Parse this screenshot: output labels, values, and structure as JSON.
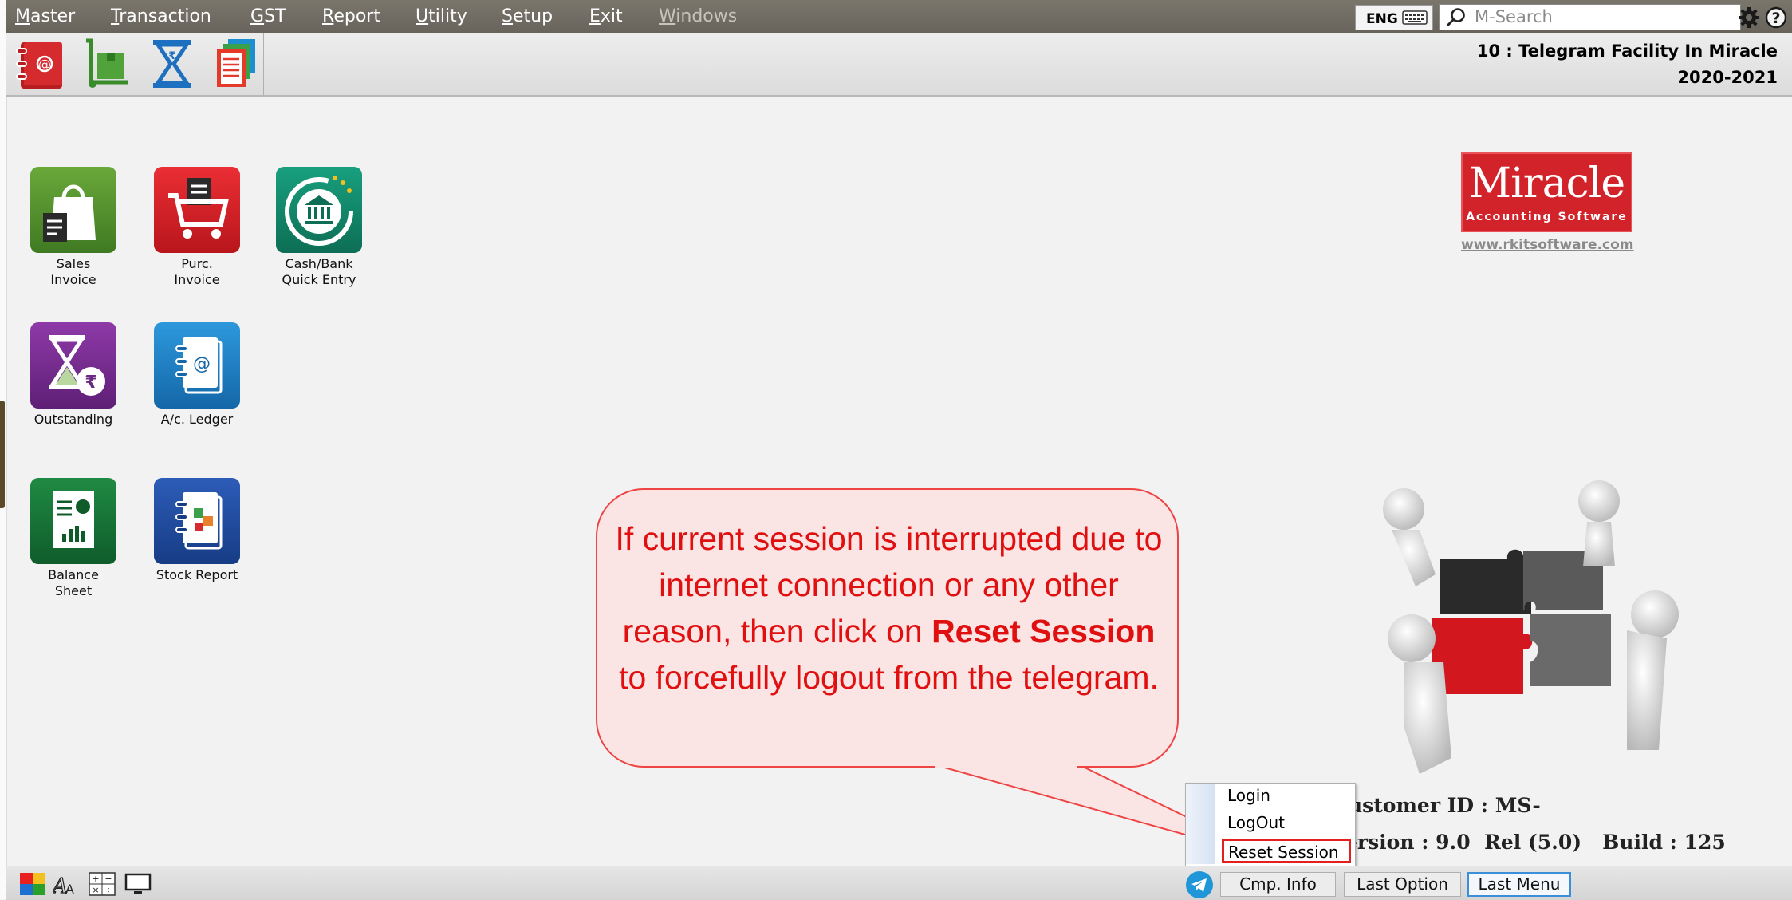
{
  "menubar": {
    "items": [
      {
        "key": "M",
        "rest": "aster"
      },
      {
        "key": "T",
        "rest": "ransaction"
      },
      {
        "key": "G",
        "rest": "ST"
      },
      {
        "key": "R",
        "rest": "eport"
      },
      {
        "key": "U",
        "rest": "tility"
      },
      {
        "key": "S",
        "rest": "etup"
      },
      {
        "key": "E",
        "rest": "xit"
      },
      {
        "key": "W",
        "rest": "indows"
      }
    ],
    "language": "ENG",
    "search_placeholder": "M-Search"
  },
  "toolbar": {
    "icons": [
      "ledger-book-icon",
      "trolley-box-icon",
      "rupee-hourglass-icon",
      "report-stack-icon"
    ],
    "company_line1": "10 : Telegram Facility In Miracle",
    "company_line2": "2020-2021"
  },
  "desktop": {
    "icons": [
      {
        "name": "sales-invoice",
        "label1": "Sales",
        "label2": "Invoice",
        "color": "#4f8a2a"
      },
      {
        "name": "purc-invoice",
        "label1": "Purc.",
        "label2": "Invoice",
        "color": "#d91f26"
      },
      {
        "name": "cash-bank-quick-entry",
        "label1": "Cash/Bank",
        "label2": "Quick Entry",
        "color": "#12876b"
      },
      {
        "name": "outstanding",
        "label1": "Outstanding",
        "label2": "",
        "color": "#7a2a8c"
      },
      {
        "name": "ac-ledger",
        "label1": "A/c. Ledger",
        "label2": "",
        "color": "#1b7fc4"
      },
      {
        "name": "balance-sheet",
        "label1": "Balance",
        "label2": "Sheet",
        "color": "#1a7a3a"
      },
      {
        "name": "stock-report",
        "label1": "Stock Report",
        "label2": "",
        "color": "#1a4fa0"
      }
    ]
  },
  "logo": {
    "main": "Miracle",
    "sub": "Accounting Software",
    "url": "www.rkitsoftware.com",
    "color": "#d2232a"
  },
  "info": {
    "customer_id": "ustomer ID : MS-",
    "version": "ersion : 9.0  Rel (5.0)   Build : 125"
  },
  "callout": {
    "text_before": "If current session is interrupted due to internet connection or any other reason, then click on ",
    "text_bold": "Reset Session",
    "text_after": " to forcefully logout from the telegram."
  },
  "context_menu": {
    "login": "Login",
    "logout": "LogOut",
    "reset_session": "Reset Session"
  },
  "statusbar": {
    "cmp_info": "Cmp. Info",
    "last_option": "Last Option",
    "last_menu": "Last Menu"
  }
}
